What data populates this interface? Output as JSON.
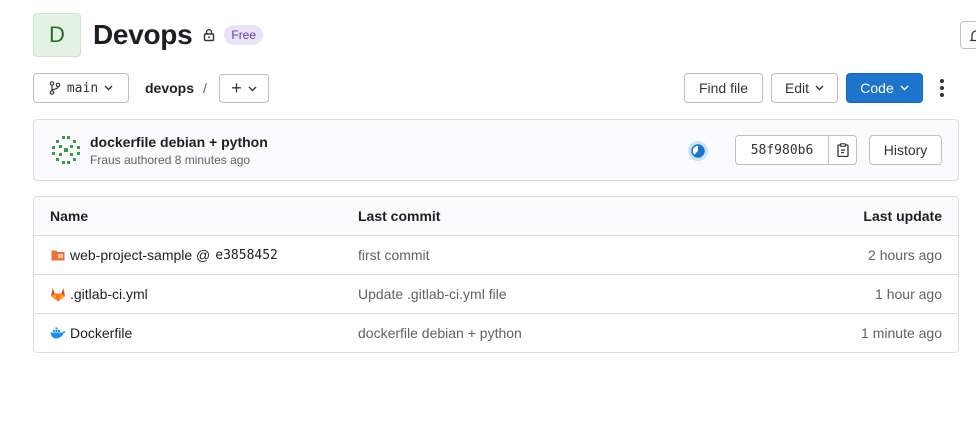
{
  "project": {
    "avatar_letter": "D",
    "name": "Devops",
    "visibility_badge": "Free"
  },
  "toolbar": {
    "branch": "main",
    "breadcrumb": "devops",
    "breadcrumb_separator": "/",
    "add_label": "+",
    "find_file_label": "Find file",
    "edit_label": "Edit",
    "code_label": "Code"
  },
  "commit": {
    "title": "dockerfile debian + python",
    "meta": "Fraus authored 8 minutes ago",
    "sha": "58f980b6",
    "history_label": "History"
  },
  "table": {
    "headers": {
      "name": "Name",
      "last_commit": "Last commit",
      "last_update": "Last update"
    },
    "rows": [
      {
        "name": "web-project-sample @",
        "submodule_hash": "e3858452",
        "icon": "submodule-folder-icon",
        "last_commit": "first commit",
        "last_update": "2 hours ago"
      },
      {
        "name": ".gitlab-ci.yml",
        "icon": "gitlab-icon",
        "last_commit": "Update .gitlab-ci.yml file",
        "last_update": "1 hour ago"
      },
      {
        "name": "Dockerfile",
        "icon": "docker-icon",
        "last_commit": "dockerfile debian + python",
        "last_update": "1 minute ago"
      }
    ]
  },
  "colors": {
    "primary": "#1f75cb",
    "badge_bg": "#e9e3f5",
    "avatar_bg": "#e3f2e3"
  }
}
